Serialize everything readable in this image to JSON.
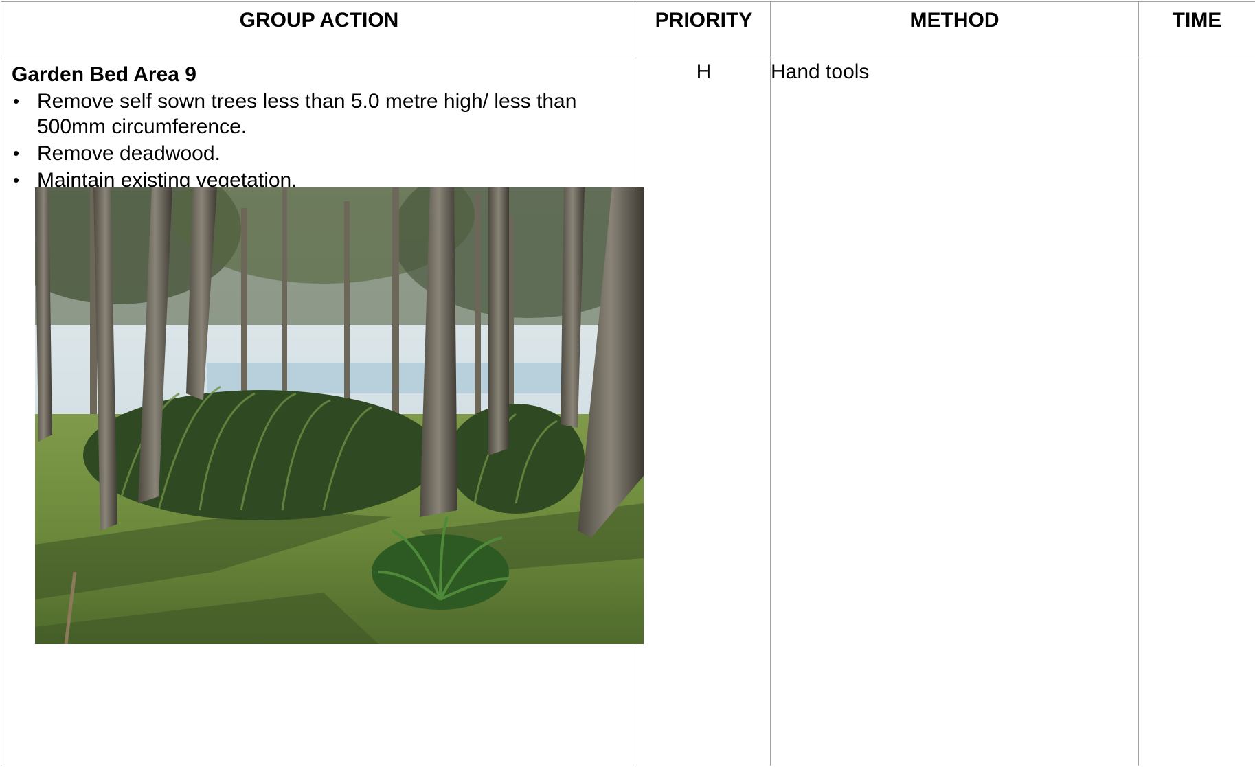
{
  "table": {
    "headers": {
      "group_action": "GROUP ACTION",
      "priority": "PRIORITY",
      "method": "METHOD",
      "time": "TIME"
    },
    "row": {
      "title": "Garden Bed Area 9",
      "actions": [
        "Remove self sown trees less than 5.0 metre high/ less than 500mm circumference.",
        "Remove deadwood.",
        "Maintain existing vegetation."
      ],
      "priority": "H",
      "method": "Hand tools",
      "time": ""
    }
  },
  "photo": {
    "description_icon": "photo-garden-bed"
  }
}
